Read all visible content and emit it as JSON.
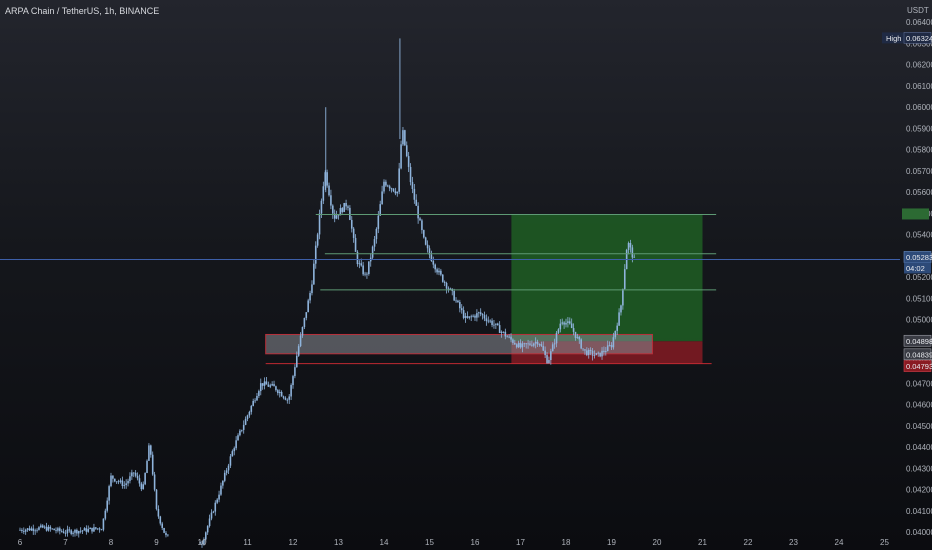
{
  "header": {
    "symbol": "ARPA Chain / TetherUS, 1h, BINANCE",
    "currency": "USDT"
  },
  "colors": {
    "candle": "#8fb4dc",
    "profit_zone": "#1e5a24",
    "loss_zone": "#7d1b22",
    "support_box": "#8a8d95",
    "support_box_border": "#b8303a",
    "price_line": "#3d5fa8",
    "level_line": "#5e9a74",
    "bottom_line": "#c02a32"
  },
  "chart_data": {
    "type": "candlestick",
    "title": "ARPA Chain / TetherUS, 1h, BINANCE",
    "xlabel": "",
    "ylabel": "",
    "yunit": "USDT",
    "ylim": [
      0.04,
      0.065
    ],
    "x_ticks": [
      "6",
      "7",
      "8",
      "9",
      "10",
      "11",
      "12",
      "13",
      "14",
      "15",
      "16",
      "17",
      "18",
      "19",
      "20",
      "21",
      "22",
      "23",
      "24",
      "25"
    ],
    "y_ticks": [
      "0.06400",
      "0.06300",
      "0.06200",
      "0.06100",
      "0.06000",
      "0.05900",
      "0.05800",
      "0.05700",
      "0.05600",
      "0.05500",
      "0.05400",
      "0.05300",
      "0.05200",
      "0.05100",
      "0.05000",
      "0.04900",
      "0.04800",
      "0.04700",
      "0.04600",
      "0.04500",
      "0.04400",
      "0.04300",
      "0.04200",
      "0.04100",
      "0.04000"
    ],
    "scale_tags": [
      {
        "label": "High",
        "value": "0.06324"
      },
      {
        "label": "",
        "value": "0.05283"
      },
      {
        "label": "",
        "value": "04:02"
      },
      {
        "label": "",
        "value": "0.04898"
      },
      {
        "label": "",
        "value": "0.04839"
      },
      {
        "label": "",
        "value": "0.04793"
      }
    ],
    "price_path": [
      {
        "day": 6.0,
        "price": 0.0401
      },
      {
        "day": 6.5,
        "price": 0.0402
      },
      {
        "day": 7.0,
        "price": 0.04
      },
      {
        "day": 7.5,
        "price": 0.0401
      },
      {
        "day": 7.8,
        "price": 0.0402
      },
      {
        "day": 8.0,
        "price": 0.0426
      },
      {
        "day": 8.3,
        "price": 0.0422
      },
      {
        "day": 8.5,
        "price": 0.0428
      },
      {
        "day": 8.7,
        "price": 0.042
      },
      {
        "day": 8.85,
        "price": 0.0442
      },
      {
        "day": 9.0,
        "price": 0.041
      },
      {
        "day": 9.2,
        "price": 0.0398
      },
      {
        "day": 10.0,
        "price": 0.0395
      },
      {
        "day": 10.4,
        "price": 0.042
      },
      {
        "day": 10.7,
        "price": 0.044
      },
      {
        "day": 11.0,
        "price": 0.0455
      },
      {
        "day": 11.3,
        "price": 0.047
      },
      {
        "day": 11.6,
        "price": 0.0468
      },
      {
        "day": 11.9,
        "price": 0.0462
      },
      {
        "day": 12.1,
        "price": 0.0485
      },
      {
        "day": 12.4,
        "price": 0.0515
      },
      {
        "day": 12.7,
        "price": 0.057
      },
      {
        "day": 12.9,
        "price": 0.0548
      },
      {
        "day": 13.2,
        "price": 0.0555
      },
      {
        "day": 13.4,
        "price": 0.0528
      },
      {
        "day": 13.6,
        "price": 0.052
      },
      {
        "day": 13.8,
        "price": 0.0538
      },
      {
        "day": 14.0,
        "price": 0.0565
      },
      {
        "day": 14.3,
        "price": 0.056
      },
      {
        "day": 14.4,
        "price": 0.059
      },
      {
        "day": 14.6,
        "price": 0.0563
      },
      {
        "day": 14.9,
        "price": 0.0535
      },
      {
        "day": 15.2,
        "price": 0.0522
      },
      {
        "day": 15.5,
        "price": 0.0512
      },
      {
        "day": 15.8,
        "price": 0.05
      },
      {
        "day": 16.1,
        "price": 0.0503
      },
      {
        "day": 16.4,
        "price": 0.0498
      },
      {
        "day": 16.7,
        "price": 0.0492
      },
      {
        "day": 17.0,
        "price": 0.0487
      },
      {
        "day": 17.4,
        "price": 0.049
      },
      {
        "day": 17.6,
        "price": 0.048
      },
      {
        "day": 17.9,
        "price": 0.05
      },
      {
        "day": 18.1,
        "price": 0.0497
      },
      {
        "day": 18.4,
        "price": 0.0485
      },
      {
        "day": 18.7,
        "price": 0.0483
      },
      {
        "day": 19.0,
        "price": 0.0488
      },
      {
        "day": 19.2,
        "price": 0.0505
      },
      {
        "day": 19.35,
        "price": 0.0537
      },
      {
        "day": 19.5,
        "price": 0.0528
      }
    ],
    "position": {
      "entry": 0.04898,
      "target": 0.05495,
      "stop": 0.04793,
      "start_day": 16.8,
      "end_day": 21.0
    },
    "support_zone": {
      "low": 0.04839,
      "high": 0.0493,
      "start_day": 11.4,
      "end_day": 19.9
    },
    "levels": [
      {
        "value": 0.05495,
        "start_day": 12.5,
        "end_day": 21.3
      },
      {
        "value": 0.0531,
        "start_day": 12.7,
        "end_day": 21.3
      },
      {
        "value": 0.0514,
        "start_day": 12.6,
        "end_day": 21.3
      }
    ],
    "current_price": 0.05283,
    "grid": false
  }
}
